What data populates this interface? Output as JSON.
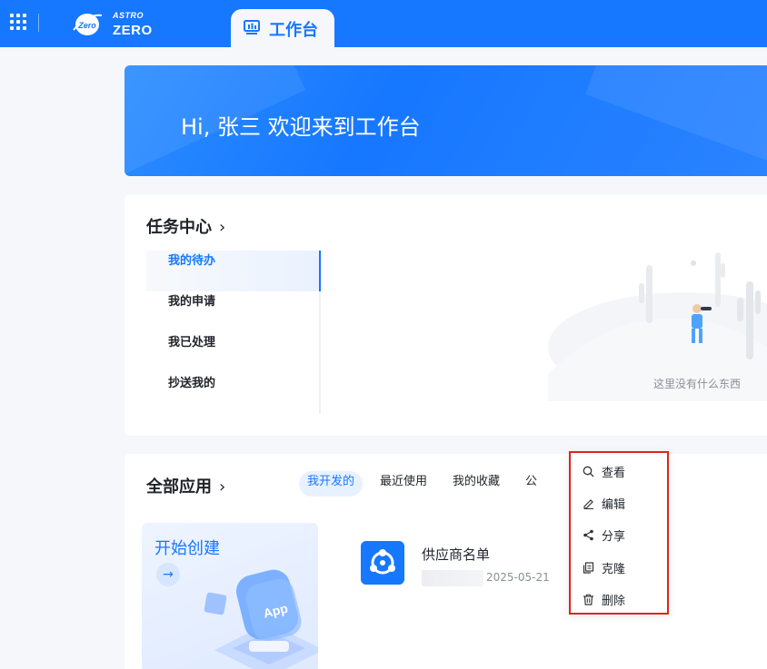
{
  "header": {
    "logo_small": "ASTRO",
    "logo_main": "ZERO",
    "logo_badge": "Zero",
    "active_tab": "工作台"
  },
  "banner": {
    "greeting": "Hi, 张三 欢迎来到工作台"
  },
  "task_center": {
    "title": "任务中心",
    "items": [
      {
        "label": "我的待办",
        "active": true
      },
      {
        "label": "我的申请",
        "active": false
      },
      {
        "label": "我已处理",
        "active": false
      },
      {
        "label": "抄送我的",
        "active": false
      }
    ],
    "empty_text": "这里没有什么东西"
  },
  "apps": {
    "title": "全部应用",
    "filters": [
      {
        "label": "我开发的",
        "active": true
      },
      {
        "label": "最近使用",
        "active": false
      },
      {
        "label": "我的收藏",
        "active": false
      },
      {
        "label": "公",
        "active": false
      }
    ],
    "create_tile": {
      "label": "开始创建",
      "badge": "App"
    },
    "app_list": [
      {
        "name": "供应商名单",
        "date": "2025-05-21"
      }
    ]
  },
  "context_menu": {
    "items": [
      {
        "label": "查看",
        "icon": "search-icon"
      },
      {
        "label": "编辑",
        "icon": "edit-icon"
      },
      {
        "label": "分享",
        "icon": "share-icon"
      },
      {
        "label": "克隆",
        "icon": "copy-icon"
      },
      {
        "label": "删除",
        "icon": "trash-icon"
      }
    ]
  },
  "colors": {
    "primary": "#1677ff",
    "highlight_border": "#e0241b"
  }
}
